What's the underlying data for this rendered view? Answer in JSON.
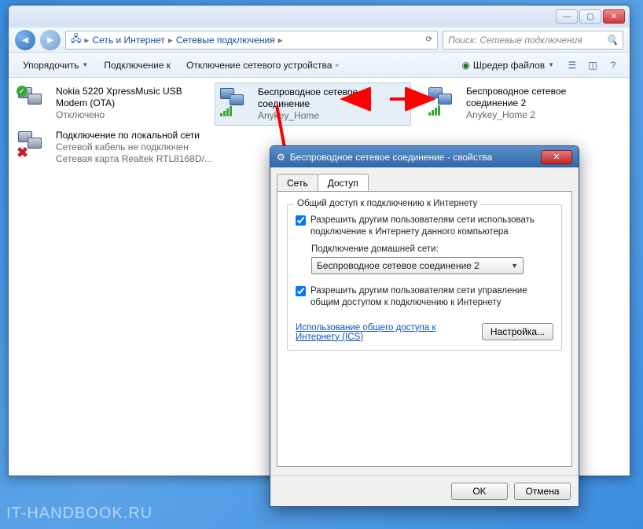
{
  "explorer": {
    "breadcrumb": {
      "l1": "Сеть и Интернет",
      "l2": "Сетевые подключения"
    },
    "search_placeholder": "Поиск: Сетевые подключения",
    "toolbar": {
      "organize": "Упорядочить",
      "connect": "Подключение к",
      "disable": "Отключение сетевого устройства",
      "shredder": "Шредер файлов"
    },
    "connections": {
      "c1": {
        "title": "Nokia 5220 XpressMusic USB Modem (OTA)",
        "sub": "Отключено"
      },
      "c2": {
        "title": "Беспроводное сетевое соединение",
        "sub": "Anykey_Home"
      },
      "c3": {
        "title": "Беспроводное сетевое соединение 2",
        "sub": "Anykey_Home 2"
      },
      "c4": {
        "title": "Подключение по локальной сети",
        "sub1": "Сетевой кабель не подключен",
        "sub2": "Сетевая карта Realtek RTL8168D/..."
      }
    }
  },
  "dialog": {
    "title": "Беспроводное сетевое соединение - свойства",
    "tabs": {
      "net": "Сеть",
      "share": "Доступ"
    },
    "group_legend": "Общий доступ к подключению к Интернету",
    "chk1": "Разрешить другим пользователям сети использовать подключение к Интернету данного компьютера",
    "home_label": "Подключение домашней сети:",
    "select_value": "Беспроводное сетевое соединение 2",
    "chk2": "Разрешить другим пользователям сети управление общим доступом к подключению к Интернету",
    "link": "Использование общего доступа к Интернету (ICS)",
    "settings_btn": "Настройка...",
    "ok": "OK",
    "cancel": "Отмена"
  },
  "watermark": "IT-HANDBOOK.RU"
}
